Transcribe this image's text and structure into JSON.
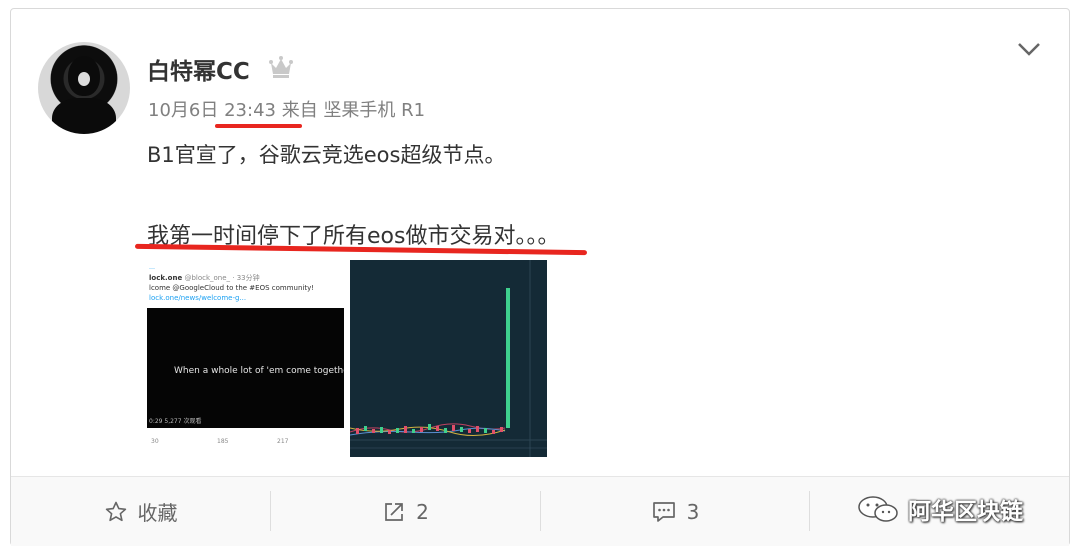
{
  "post": {
    "username": "白特幂CC",
    "meta_date": "10月6日",
    "meta_time": "23:43",
    "meta_from": "来自 坚果手机 R1",
    "text_line1": "B1官宣了，谷歌云竞选eos超级节点。",
    "text_line2": "我第一时间停下了所有eos做市交易对。。。"
  },
  "thumb1": {
    "account": "lock.one",
    "handle": "@block_one_ · 33分钟",
    "tweet_line1": "lcome @GoogleCloud to the #EOS community!",
    "tweet_line2": "lock.one/news/welcome-g...",
    "video_caption": "When a whole lot of 'em come together",
    "video_time": "0:29  5,277 次观看",
    "action_reply": "30",
    "action_retweet": "185",
    "action_like": "217"
  },
  "footer": {
    "favorite_label": "收藏",
    "share_count": "2",
    "comment_count": "3"
  },
  "watermark": {
    "text": "阿华区块链"
  },
  "colors": {
    "annotation_red": "#e8261f",
    "text_gray": "#808080",
    "chart_bg": "#142a36",
    "chart_green": "#3fd08e"
  },
  "icons": [
    "crown-icon",
    "chevron-down-icon",
    "star-icon",
    "share-icon",
    "comment-icon",
    "wechat-icon"
  ]
}
